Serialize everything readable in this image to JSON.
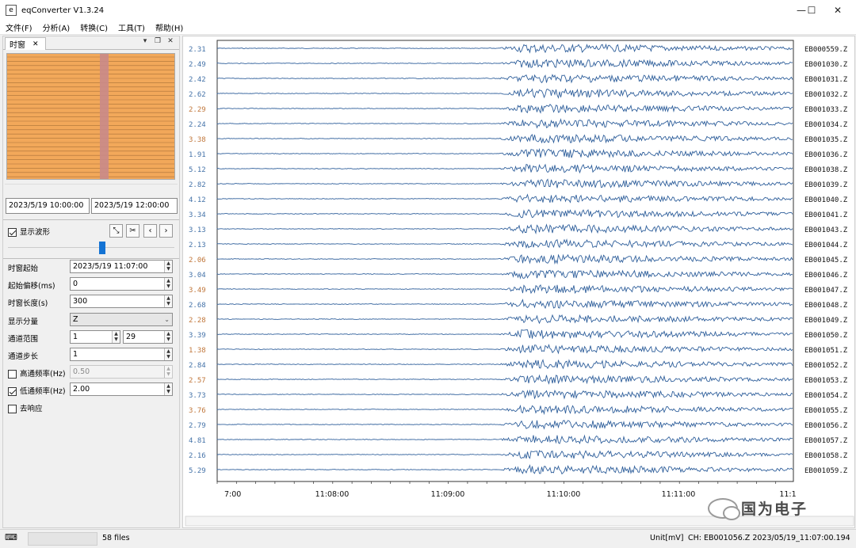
{
  "window": {
    "title": "eqConverter V1.3.24",
    "minimize_glyph": "—",
    "maximize_glyph": "☐",
    "close_glyph": "✕"
  },
  "menu": [
    "文件(F)",
    "分析(A)",
    "转换(C)",
    "工具(T)",
    "帮助(H)"
  ],
  "panel": {
    "tab_label": "时窗",
    "tab_close": "✕",
    "pin_glyph": "▾",
    "float_glyph": "❐",
    "close_glyph": "✕",
    "start_datetime": "2023/5/19 10:00:00",
    "end_datetime": "2023/5/19 12:00:00",
    "show_waveform_label": "显示波形",
    "show_waveform_checked": true,
    "fields": {
      "window_start": {
        "label": "时窗起始",
        "value": "2023/5/19 11:07:00"
      },
      "start_offset": {
        "label": "起始偏移(ms)",
        "value": "0"
      },
      "window_length": {
        "label": "时窗长度(s)",
        "value": "300"
      },
      "component": {
        "label": "显示分量",
        "value": "Z"
      },
      "channel_range": {
        "label": "通道范围",
        "from": "1",
        "to": "29"
      },
      "channel_step": {
        "label": "通道步长",
        "value": "1"
      },
      "highpass": {
        "label": "高通频率(Hz)",
        "value": "0.50",
        "checked": false
      },
      "lowpass": {
        "label": "低通频率(Hz)",
        "value": "2.00",
        "checked": true
      },
      "deresponse": {
        "label": "去响应",
        "checked": false
      }
    }
  },
  "chart_data": {
    "type": "line",
    "title": "",
    "xlabel": "",
    "ylabel": "",
    "x_ticks": [
      "7:00",
      "11:08:00",
      "11:09:00",
      "11:10:00",
      "11:11:00",
      "11:1"
    ],
    "channels": [
      {
        "name": "EB000559.Z",
        "amplitude": "2.31"
      },
      {
        "name": "EB001030.Z",
        "amplitude": "2.49"
      },
      {
        "name": "EB001031.Z",
        "amplitude": "2.42"
      },
      {
        "name": "EB001032.Z",
        "amplitude": "2.62"
      },
      {
        "name": "EB001033.Z",
        "amplitude": "2.29"
      },
      {
        "name": "EB001034.Z",
        "amplitude": "2.24"
      },
      {
        "name": "EB001035.Z",
        "amplitude": "3.38"
      },
      {
        "name": "EB001036.Z",
        "amplitude": "1.91"
      },
      {
        "name": "EB001038.Z",
        "amplitude": "5.12"
      },
      {
        "name": "EB001039.Z",
        "amplitude": "2.82"
      },
      {
        "name": "EB001040.Z",
        "amplitude": "4.12"
      },
      {
        "name": "EB001041.Z",
        "amplitude": "3.34"
      },
      {
        "name": "EB001043.Z",
        "amplitude": "3.13"
      },
      {
        "name": "EB001044.Z",
        "amplitude": "2.13"
      },
      {
        "name": "EB001045.Z",
        "amplitude": "2.06"
      },
      {
        "name": "EB001046.Z",
        "amplitude": "3.04"
      },
      {
        "name": "EB001047.Z",
        "amplitude": "3.49"
      },
      {
        "name": "EB001048.Z",
        "amplitude": "2.68"
      },
      {
        "name": "EB001049.Z",
        "amplitude": "2.28"
      },
      {
        "name": "EB001050.Z",
        "amplitude": "3.39"
      },
      {
        "name": "EB001051.Z",
        "amplitude": "1.38"
      },
      {
        "name": "EB001052.Z",
        "amplitude": "2.84"
      },
      {
        "name": "EB001053.Z",
        "amplitude": "2.57"
      },
      {
        "name": "EB001054.Z",
        "amplitude": "3.73"
      },
      {
        "name": "EB001055.Z",
        "amplitude": "3.76"
      },
      {
        "name": "EB001056.Z",
        "amplitude": "2.79"
      },
      {
        "name": "EB001057.Z",
        "amplitude": "4.81"
      },
      {
        "name": "EB001058.Z",
        "amplitude": "2.16"
      },
      {
        "name": "EB001059.Z",
        "amplitude": "5.29"
      }
    ],
    "amplitude_color_normal": "#4472a8",
    "amplitude_color_alt": "#c0763a",
    "trace_color": "#2f5f9b",
    "grid": false
  },
  "status": {
    "file_count": "58 files",
    "unit": "Unit[mV]",
    "channel_info": "CH: EB001056.Z   2023/05/19_11:07:00.194"
  },
  "watermark": {
    "text": "国为电子"
  }
}
